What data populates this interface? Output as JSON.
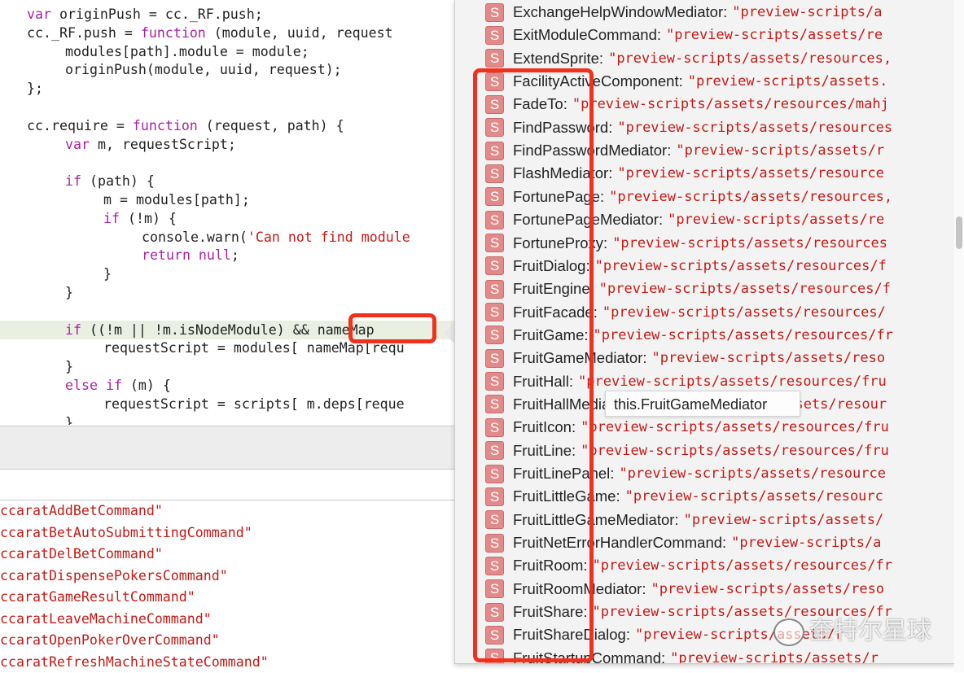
{
  "editor": {
    "lines": [
      {
        "indent": 0,
        "tokens": [
          {
            "t": "kw",
            "v": "var"
          },
          {
            "t": "plain",
            "v": " originPush = cc._RF.push;"
          }
        ]
      },
      {
        "indent": 0,
        "tokens": [
          {
            "t": "plain",
            "v": "cc._RF.push = "
          },
          {
            "t": "kw",
            "v": "function"
          },
          {
            "t": "plain",
            "v": " (module, uuid, request"
          }
        ]
      },
      {
        "indent": 1,
        "tokens": [
          {
            "t": "plain",
            "v": "modules[path].module = module;"
          }
        ]
      },
      {
        "indent": 1,
        "tokens": [
          {
            "t": "plain",
            "v": "originPush(module, uuid, request);"
          }
        ]
      },
      {
        "indent": 0,
        "tokens": [
          {
            "t": "plain",
            "v": "};"
          }
        ]
      },
      {
        "indent": 0,
        "tokens": []
      },
      {
        "indent": 0,
        "tokens": [
          {
            "t": "plain",
            "v": "cc.require = "
          },
          {
            "t": "kw",
            "v": "function"
          },
          {
            "t": "plain",
            "v": " (request, path) {"
          }
        ]
      },
      {
        "indent": 1,
        "tokens": [
          {
            "t": "kw",
            "v": "var"
          },
          {
            "t": "plain",
            "v": " m, requestScript;"
          }
        ]
      },
      {
        "indent": 0,
        "tokens": []
      },
      {
        "indent": 1,
        "tokens": [
          {
            "t": "kw",
            "v": "if"
          },
          {
            "t": "plain",
            "v": " (path) {"
          }
        ]
      },
      {
        "indent": 2,
        "tokens": [
          {
            "t": "plain",
            "v": "m = modules[path];"
          }
        ]
      },
      {
        "indent": 2,
        "tokens": [
          {
            "t": "kw",
            "v": "if"
          },
          {
            "t": "plain",
            "v": " (!m) {"
          }
        ]
      },
      {
        "indent": 3,
        "tokens": [
          {
            "t": "plain",
            "v": "console.warn("
          },
          {
            "t": "str",
            "v": "'Can not find module"
          }
        ]
      },
      {
        "indent": 3,
        "tokens": [
          {
            "t": "kw",
            "v": "return null"
          },
          {
            "t": "plain",
            "v": ";"
          }
        ]
      },
      {
        "indent": 2,
        "tokens": [
          {
            "t": "plain",
            "v": "}"
          }
        ]
      },
      {
        "indent": 1,
        "tokens": [
          {
            "t": "plain",
            "v": "}"
          }
        ]
      },
      {
        "indent": 0,
        "tokens": []
      },
      {
        "indent": 1,
        "highlight": true,
        "tokens": [
          {
            "t": "kw",
            "v": "if"
          },
          {
            "t": "plain",
            "v": " ((!m || !m.isNodeModule) && nameMap"
          }
        ]
      },
      {
        "indent": 2,
        "tokens": [
          {
            "t": "plain",
            "v": "requestScript = modules[ nameMap[requ"
          }
        ]
      },
      {
        "indent": 1,
        "tokens": [
          {
            "t": "plain",
            "v": "}"
          }
        ]
      },
      {
        "indent": 1,
        "tokens": [
          {
            "t": "kw",
            "v": "else if"
          },
          {
            "t": "plain",
            "v": " (m) {"
          }
        ]
      },
      {
        "indent": 2,
        "tokens": [
          {
            "t": "plain",
            "v": "requestScript = scripts[ m.deps[reque"
          }
        ]
      },
      {
        "indent": 1,
        "tokens": [
          {
            "t": "plain",
            "v": "}"
          }
        ]
      }
    ]
  },
  "console": {
    "lines": [
      "ccaratAddBetCommand\"",
      "ccaratBetAutoSubmittingCommand\"",
      "ccaratDelBetCommand\"",
      "ccaratDispensePokersCommand\"",
      "ccaratGameResultCommand\"",
      "ccaratLeaveMachineCommand\"",
      "ccaratOpenPokerOverCommand\"",
      "ccaratRefreshMachineStateCommand\""
    ]
  },
  "autocomplete": {
    "icon": "script-icon",
    "icon_letter": "S",
    "items": [
      {
        "name": "ExchangeHelpWindowMediator:",
        "value": "\"preview-scripts/a"
      },
      {
        "name": "ExitModuleCommand:",
        "value": "\"preview-scripts/assets/re"
      },
      {
        "name": "ExtendSprite:",
        "value": "\"preview-scripts/assets/resources,"
      },
      {
        "name": "FacilityActiveComponent:",
        "value": "\"preview-scripts/assets."
      },
      {
        "name": "FadeTo:",
        "value": "\"preview-scripts/assets/resources/mahj"
      },
      {
        "name": "FindPassword:",
        "value": "\"preview-scripts/assets/resources"
      },
      {
        "name": "FindPasswordMediator:",
        "value": "\"preview-scripts/assets/r"
      },
      {
        "name": "FlashMediator:",
        "value": "\"preview-scripts/assets/resource"
      },
      {
        "name": "FortunePage:",
        "value": "\"preview-scripts/assets/resources,"
      },
      {
        "name": "FortunePageMediator:",
        "value": "\"preview-scripts/assets/re"
      },
      {
        "name": "FortuneProxy:",
        "value": "\"preview-scripts/assets/resources"
      },
      {
        "name": "FruitDialog:",
        "value": "\"preview-scripts/assets/resources/f"
      },
      {
        "name": "FruitEngine:",
        "value": "\"preview-scripts/assets/resources/f"
      },
      {
        "name": "FruitFacade:",
        "value": "\"preview-scripts/assets/resources/"
      },
      {
        "name": "FruitGame:",
        "value": "\"preview-scripts/assets/resources/fr"
      },
      {
        "name": "FruitGameMediator:",
        "value": "\"preview-scripts/assets/reso"
      },
      {
        "name": "FruitHall:",
        "value": "\"preview-scripts/assets/resources/fru"
      },
      {
        "name": "FruitHallMediator:",
        "value": "\"preview-scripts/assets/resour"
      },
      {
        "name": "FruitIcon:",
        "value": "\"preview-scripts/assets/resources/fru"
      },
      {
        "name": "FruitLine:",
        "value": "\"preview-scripts/assets/resources/fru"
      },
      {
        "name": "FruitLinePanel:",
        "value": "\"preview-scripts/assets/resource"
      },
      {
        "name": "FruitLittleGame:",
        "value": "\"preview-scripts/assets/resourc"
      },
      {
        "name": "FruitLittleGameMediator:",
        "value": "\"preview-scripts/assets/"
      },
      {
        "name": "FruitNetErrorHandlerCommand:",
        "value": "\"preview-scripts/a"
      },
      {
        "name": "FruitRoom:",
        "value": "\"preview-scripts/assets/resources/fr"
      },
      {
        "name": "FruitRoomMediator:",
        "value": "\"preview-scripts/assets/reso"
      },
      {
        "name": "FruitShare:",
        "value": "\"preview-scripts/assets/resources/fr"
      },
      {
        "name": "FruitShareDialog:",
        "value": "\"preview-scripts/assets/r"
      },
      {
        "name": "FruitStartupCommand:",
        "value": "\"preview-scripts/assets/r"
      }
    ]
  },
  "tooltip": {
    "text": "this.FruitGameMediator"
  },
  "watermark": {
    "text": "奎特尔星球"
  },
  "colors": {
    "keyword": "#aa22a0",
    "string": "#c41a16",
    "annotation": "#f2301e",
    "icon_bg": "#e28a8a",
    "highlight_line": "#e9f0e2"
  }
}
